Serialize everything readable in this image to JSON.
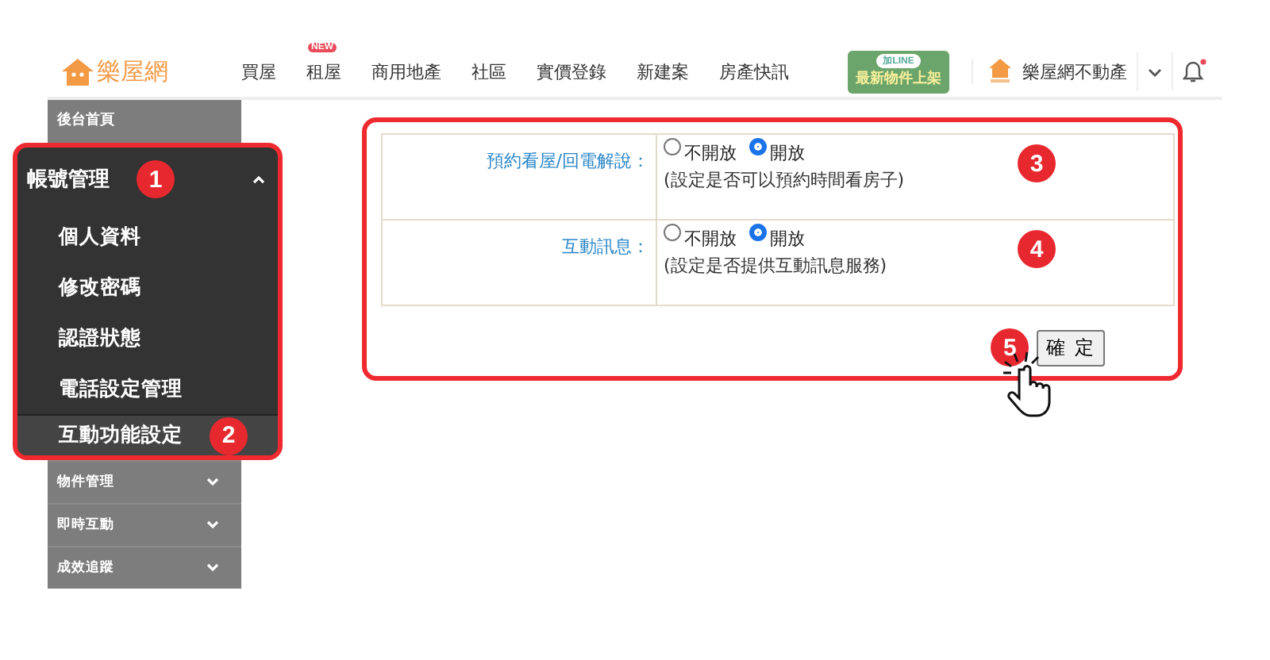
{
  "header": {
    "logo": "樂屋網",
    "nav": [
      {
        "label": "買屋"
      },
      {
        "label": "租屋",
        "badge": "NEW"
      },
      {
        "label": "商用地產"
      },
      {
        "label": "社區"
      },
      {
        "label": "實價登錄"
      },
      {
        "label": "新建案"
      },
      {
        "label": "房產快訊"
      }
    ],
    "line_banner": {
      "tag": "加LINE",
      "text": "最新物件上架"
    },
    "account": "樂屋網不動產",
    "unread_notifications": true
  },
  "sidebar": {
    "home": "後台首頁",
    "groups": [
      {
        "label": "帳號管理",
        "expanded": true,
        "callout": "1",
        "children": [
          {
            "label": "個人資料",
            "selected": false
          },
          {
            "label": "修改密碼",
            "selected": false
          },
          {
            "label": "認證狀態",
            "selected": false
          },
          {
            "label": "電話設定管理",
            "selected": false
          },
          {
            "label": "互動功能設定",
            "selected": true,
            "callout": "2"
          }
        ]
      },
      {
        "label": "物件管理",
        "expanded": false
      },
      {
        "label": "即時互動",
        "expanded": false
      },
      {
        "label": "成效追蹤",
        "expanded": false
      }
    ]
  },
  "settings": {
    "rows": [
      {
        "label": "預約看屋/回電解說：",
        "options": [
          {
            "label": "不開放",
            "selected": false
          },
          {
            "label": "開放",
            "selected": true
          }
        ],
        "hint": "(設定是否可以預約時間看房子)",
        "callout": "3"
      },
      {
        "label": "互動訊息：",
        "options": [
          {
            "label": "不開放",
            "selected": false
          },
          {
            "label": "開放",
            "selected": true
          }
        ],
        "hint": "(設定是否提供互動訊息服務)",
        "callout": "4"
      }
    ],
    "button": {
      "label": "確 定",
      "callout": "5"
    }
  }
}
